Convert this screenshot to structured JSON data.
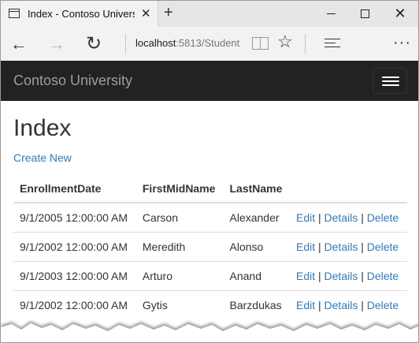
{
  "browser": {
    "tab_title": "Index - Contoso Univers",
    "url_host": "localhost",
    "url_rest": ":5813/Student",
    "icons": {
      "tab": "page-icon",
      "close_tab": "close-icon",
      "new_tab": "plus-icon",
      "back": "back-arrow-icon",
      "forward": "forward-arrow-icon",
      "refresh": "refresh-icon",
      "reading_view": "book-icon",
      "favorite": "star-icon",
      "hub": "hub-icon",
      "more": "more-icon",
      "minimize": "minimize-icon",
      "maximize": "maximize-icon",
      "close_window": "close-icon"
    }
  },
  "site": {
    "brand": "Contoso University",
    "toggler_icon": "hamburger-icon",
    "colors": {
      "navbar": "#222222",
      "brand": "#9d9d9d",
      "link": "#337ab7",
      "text": "#333333"
    }
  },
  "page": {
    "title": "Index",
    "create_link": "Create New"
  },
  "table": {
    "headers": [
      "EnrollmentDate",
      "FirstMidName",
      "LastName"
    ],
    "rows": [
      {
        "enrollment": "9/1/2005 12:00:00 AM",
        "first": "Carson",
        "last": "Alexander",
        "edit": "Edit",
        "sep": "|",
        "details": "Details",
        "sep2": "|",
        "delete": "Delete"
      },
      {
        "enrollment": "9/1/2002 12:00:00 AM",
        "first": "Meredith",
        "last": "Alonso",
        "edit": "Edit",
        "sep": "|",
        "details": "Details",
        "sep2": "|",
        "delete": "Delete"
      },
      {
        "enrollment": "9/1/2003 12:00:00 AM",
        "first": "Arturo",
        "last": "Anand",
        "edit": "Edit",
        "sep": "|",
        "details": "Details",
        "sep2": "|",
        "delete": "Delete"
      },
      {
        "enrollment": "9/1/2002 12:00:00 AM",
        "first": "Gytis",
        "last": "Barzdukas",
        "edit": "Edit",
        "sep": "|",
        "details": "Details",
        "sep2": "|",
        "delete": "Delete"
      }
    ]
  }
}
